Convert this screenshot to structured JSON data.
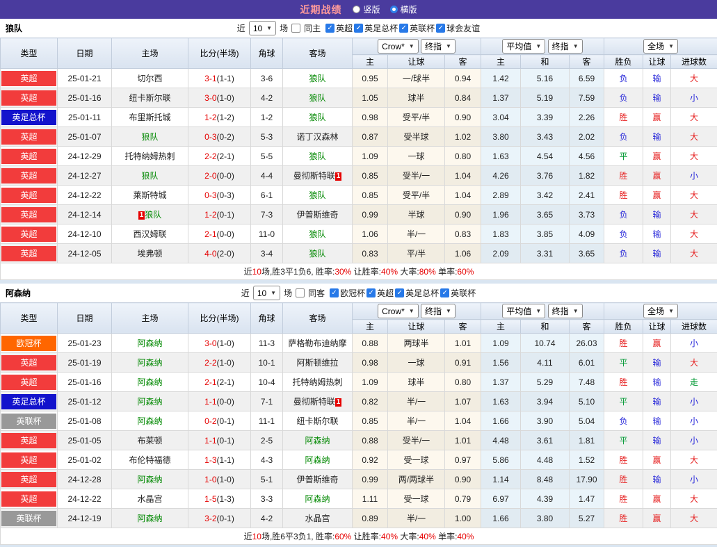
{
  "title_bar": {
    "title": "近期战绩",
    "radio_vertical": "竖版",
    "radio_horizontal": "横版",
    "selected": "横版"
  },
  "labels": {
    "near": "近",
    "games": "场"
  },
  "col_headers": {
    "type": "类型",
    "date": "日期",
    "home": "主场",
    "score": "比分(半场)",
    "corner": "角球",
    "away": "客场",
    "crow_select": "Crow*",
    "final_select": "终指",
    "avg_select": "平均值",
    "final_select2": "终指",
    "scope_select": "全场",
    "sub": [
      "主",
      "让球",
      "客",
      "主",
      "和",
      "客",
      "胜负",
      "让球",
      "进球数"
    ]
  },
  "colors": {
    "leagues": {
      "英超": "#f23c3c",
      "英足总杯": "#1313cc",
      "欧冠杯": "#ff6600",
      "英联杯": "#999999"
    },
    "results": {
      "胜": "#e62222",
      "平": "#009933",
      "负": "#2626d9",
      "赢": "#e62222",
      "输": "#2626d9",
      "大": "#e62222",
      "小": "#2626d9",
      "走": "#009933"
    },
    "accent_red": "#e60000",
    "focus_green": "#008800",
    "titlebar_purple": "#4a3b9e"
  },
  "tables": [
    {
      "team": "狼队",
      "filter": {
        "count": "10",
        "same_label": "同主",
        "same_checked": false,
        "leagues": [
          "英超",
          "英足总杯",
          "英联杯",
          "球会友谊"
        ]
      },
      "rows": [
        {
          "league": "英超",
          "date": "25-01-21",
          "home": {
            "n": "切尔西"
          },
          "score": [
            "3-1",
            "(1-1)"
          ],
          "corner": "3-6",
          "away": {
            "n": "狼队",
            "f": 1
          },
          "crow": [
            "0.95",
            "一/球半",
            "0.94"
          ],
          "avg": [
            "1.42",
            "5.16",
            "6.59"
          ],
          "res": [
            "负",
            "输",
            "大"
          ]
        },
        {
          "league": "英超",
          "date": "25-01-16",
          "home": {
            "n": "纽卡斯尔联"
          },
          "score": [
            "3-0",
            "(1-0)"
          ],
          "corner": "4-2",
          "away": {
            "n": "狼队",
            "f": 1
          },
          "crow": [
            "1.05",
            "球半",
            "0.84"
          ],
          "avg": [
            "1.37",
            "5.19",
            "7.59"
          ],
          "res": [
            "负",
            "输",
            "小"
          ]
        },
        {
          "league": "英足总杯",
          "date": "25-01-11",
          "home": {
            "n": "布里斯托城"
          },
          "score": [
            "1-2",
            "(1-2)"
          ],
          "corner": "1-2",
          "away": {
            "n": "狼队",
            "f": 1
          },
          "crow": [
            "0.98",
            "受平/半",
            "0.90"
          ],
          "avg": [
            "3.04",
            "3.39",
            "2.26"
          ],
          "res": [
            "胜",
            "赢",
            "大"
          ]
        },
        {
          "league": "英超",
          "date": "25-01-07",
          "home": {
            "n": "狼队",
            "f": 1
          },
          "score": [
            "0-3",
            "(0-2)"
          ],
          "corner": "5-3",
          "away": {
            "n": "诺丁汉森林"
          },
          "crow": [
            "0.87",
            "受半球",
            "1.02"
          ],
          "avg": [
            "3.80",
            "3.43",
            "2.02"
          ],
          "res": [
            "负",
            "输",
            "大"
          ]
        },
        {
          "league": "英超",
          "date": "24-12-29",
          "home": {
            "n": "托特纳姆热刺"
          },
          "score": [
            "2-2",
            "(2-1)"
          ],
          "corner": "5-5",
          "away": {
            "n": "狼队",
            "f": 1
          },
          "crow": [
            "1.09",
            "一球",
            "0.80"
          ],
          "avg": [
            "1.63",
            "4.54",
            "4.56"
          ],
          "res": [
            "平",
            "赢",
            "大"
          ]
        },
        {
          "league": "英超",
          "date": "24-12-27",
          "home": {
            "n": "狼队",
            "f": 1
          },
          "score": [
            "2-0",
            "(0-0)"
          ],
          "corner": "4-4",
          "away": {
            "n": "曼彻斯特联",
            "m": "1",
            "mp": "r"
          },
          "crow": [
            "0.85",
            "受半/一",
            "1.04"
          ],
          "avg": [
            "4.26",
            "3.76",
            "1.82"
          ],
          "res": [
            "胜",
            "赢",
            "小"
          ]
        },
        {
          "league": "英超",
          "date": "24-12-22",
          "home": {
            "n": "莱斯特城"
          },
          "score": [
            "0-3",
            "(0-3)"
          ],
          "corner": "6-1",
          "away": {
            "n": "狼队",
            "f": 1
          },
          "crow": [
            "0.85",
            "受平/半",
            "1.04"
          ],
          "avg": [
            "2.89",
            "3.42",
            "2.41"
          ],
          "res": [
            "胜",
            "赢",
            "大"
          ]
        },
        {
          "league": "英超",
          "date": "24-12-14",
          "home": {
            "n": "狼队",
            "f": 1,
            "m": "1",
            "mp": "l"
          },
          "score": [
            "1-2",
            "(0-1)"
          ],
          "corner": "7-3",
          "away": {
            "n": "伊普斯维奇"
          },
          "crow": [
            "0.99",
            "半球",
            "0.90"
          ],
          "avg": [
            "1.96",
            "3.65",
            "3.73"
          ],
          "res": [
            "负",
            "输",
            "大"
          ]
        },
        {
          "league": "英超",
          "date": "24-12-10",
          "home": {
            "n": "西汉姆联"
          },
          "score": [
            "2-1",
            "(0-0)"
          ],
          "corner": "11-0",
          "away": {
            "n": "狼队",
            "f": 1
          },
          "crow": [
            "1.06",
            "半/一",
            "0.83"
          ],
          "avg": [
            "1.83",
            "3.85",
            "4.09"
          ],
          "res": [
            "负",
            "输",
            "大"
          ]
        },
        {
          "league": "英超",
          "date": "24-12-05",
          "home": {
            "n": "埃弗顿"
          },
          "score": [
            "4-0",
            "(2-0)"
          ],
          "corner": "3-4",
          "away": {
            "n": "狼队",
            "f": 1
          },
          "crow": [
            "0.83",
            "平/半",
            "1.06"
          ],
          "avg": [
            "2.09",
            "3.31",
            "3.65"
          ],
          "res": [
            "负",
            "输",
            "大"
          ]
        }
      ],
      "summary": [
        {
          "t": "近"
        },
        {
          "t": "10",
          "red": true
        },
        {
          "t": "场,胜3平1负6, 胜率:"
        },
        {
          "t": "30%",
          "red": true
        },
        {
          "t": " 让胜率:"
        },
        {
          "t": "40%",
          "red": true
        },
        {
          "t": " 大率:"
        },
        {
          "t": "80%",
          "red": true
        },
        {
          "t": " 单率:"
        },
        {
          "t": "60%",
          "red": true
        }
      ]
    },
    {
      "team": "阿森纳",
      "filter": {
        "count": "10",
        "same_label": "同客",
        "same_checked": false,
        "leagues": [
          "欧冠杯",
          "英超",
          "英足总杯",
          "英联杯"
        ]
      },
      "rows": [
        {
          "league": "欧冠杯",
          "date": "25-01-23",
          "home": {
            "n": "阿森纳",
            "f": 1
          },
          "score": [
            "3-0",
            "(1-0)"
          ],
          "corner": "11-3",
          "away": {
            "n": "萨格勒布迪纳摩"
          },
          "crow": [
            "0.88",
            "两球半",
            "1.01"
          ],
          "avg": [
            "1.09",
            "10.74",
            "26.03"
          ],
          "res": [
            "胜",
            "赢",
            "小"
          ]
        },
        {
          "league": "英超",
          "date": "25-01-19",
          "home": {
            "n": "阿森纳",
            "f": 1
          },
          "score": [
            "2-2",
            "(1-0)"
          ],
          "corner": "10-1",
          "away": {
            "n": "阿斯顿维拉"
          },
          "crow": [
            "0.98",
            "一球",
            "0.91"
          ],
          "avg": [
            "1.56",
            "4.11",
            "6.01"
          ],
          "res": [
            "平",
            "输",
            "大"
          ]
        },
        {
          "league": "英超",
          "date": "25-01-16",
          "home": {
            "n": "阿森纳",
            "f": 1
          },
          "score": [
            "2-1",
            "(2-1)"
          ],
          "corner": "10-4",
          "away": {
            "n": "托特纳姆热刺"
          },
          "crow": [
            "1.09",
            "球半",
            "0.80"
          ],
          "avg": [
            "1.37",
            "5.29",
            "7.48"
          ],
          "res": [
            "胜",
            "输",
            "走"
          ]
        },
        {
          "league": "英足总杯",
          "date": "25-01-12",
          "home": {
            "n": "阿森纳",
            "f": 1
          },
          "score": [
            "1-1",
            "(0-0)"
          ],
          "corner": "7-1",
          "away": {
            "n": "曼彻斯特联",
            "m": "1",
            "mp": "r"
          },
          "crow": [
            "0.82",
            "半/一",
            "1.07"
          ],
          "avg": [
            "1.63",
            "3.94",
            "5.10"
          ],
          "res": [
            "平",
            "输",
            "小"
          ]
        },
        {
          "league": "英联杯",
          "date": "25-01-08",
          "home": {
            "n": "阿森纳",
            "f": 1
          },
          "score": [
            "0-2",
            "(0-1)"
          ],
          "corner": "11-1",
          "away": {
            "n": "纽卡斯尔联"
          },
          "crow": [
            "0.85",
            "半/一",
            "1.04"
          ],
          "avg": [
            "1.66",
            "3.90",
            "5.04"
          ],
          "res": [
            "负",
            "输",
            "小"
          ]
        },
        {
          "league": "英超",
          "date": "25-01-05",
          "home": {
            "n": "布莱顿"
          },
          "score": [
            "1-1",
            "(0-1)"
          ],
          "corner": "2-5",
          "away": {
            "n": "阿森纳",
            "f": 1
          },
          "crow": [
            "0.88",
            "受半/一",
            "1.01"
          ],
          "avg": [
            "4.48",
            "3.61",
            "1.81"
          ],
          "res": [
            "平",
            "输",
            "小"
          ]
        },
        {
          "league": "英超",
          "date": "25-01-02",
          "home": {
            "n": "布伦特福德"
          },
          "score": [
            "1-3",
            "(1-1)"
          ],
          "corner": "4-3",
          "away": {
            "n": "阿森纳",
            "f": 1
          },
          "crow": [
            "0.92",
            "受一球",
            "0.97"
          ],
          "avg": [
            "5.86",
            "4.48",
            "1.52"
          ],
          "res": [
            "胜",
            "赢",
            "大"
          ]
        },
        {
          "league": "英超",
          "date": "24-12-28",
          "home": {
            "n": "阿森纳",
            "f": 1
          },
          "score": [
            "1-0",
            "(1-0)"
          ],
          "corner": "5-1",
          "away": {
            "n": "伊普斯维奇"
          },
          "crow": [
            "0.99",
            "两/两球半",
            "0.90"
          ],
          "avg": [
            "1.14",
            "8.48",
            "17.90"
          ],
          "res": [
            "胜",
            "输",
            "小"
          ]
        },
        {
          "league": "英超",
          "date": "24-12-22",
          "home": {
            "n": "水晶宫"
          },
          "score": [
            "1-5",
            "(1-3)"
          ],
          "corner": "3-3",
          "away": {
            "n": "阿森纳",
            "f": 1
          },
          "crow": [
            "1.11",
            "受一球",
            "0.79"
          ],
          "avg": [
            "6.97",
            "4.39",
            "1.47"
          ],
          "res": [
            "胜",
            "赢",
            "大"
          ]
        },
        {
          "league": "英联杯",
          "date": "24-12-19",
          "home": {
            "n": "阿森纳",
            "f": 1
          },
          "score": [
            "3-2",
            "(0-1)"
          ],
          "corner": "4-2",
          "away": {
            "n": "水晶宫"
          },
          "crow": [
            "0.89",
            "半/一",
            "1.00"
          ],
          "avg": [
            "1.66",
            "3.80",
            "5.27"
          ],
          "res": [
            "胜",
            "赢",
            "大"
          ]
        }
      ],
      "summary": [
        {
          "t": "近"
        },
        {
          "t": "10",
          "red": true
        },
        {
          "t": "场,胜6平3负1, 胜率:"
        },
        {
          "t": "60%",
          "red": true
        },
        {
          "t": " 让胜率:"
        },
        {
          "t": "40%",
          "red": true
        },
        {
          "t": " 大率:"
        },
        {
          "t": "40%",
          "red": true
        },
        {
          "t": " 单率:"
        },
        {
          "t": "40%",
          "red": true
        }
      ]
    }
  ]
}
